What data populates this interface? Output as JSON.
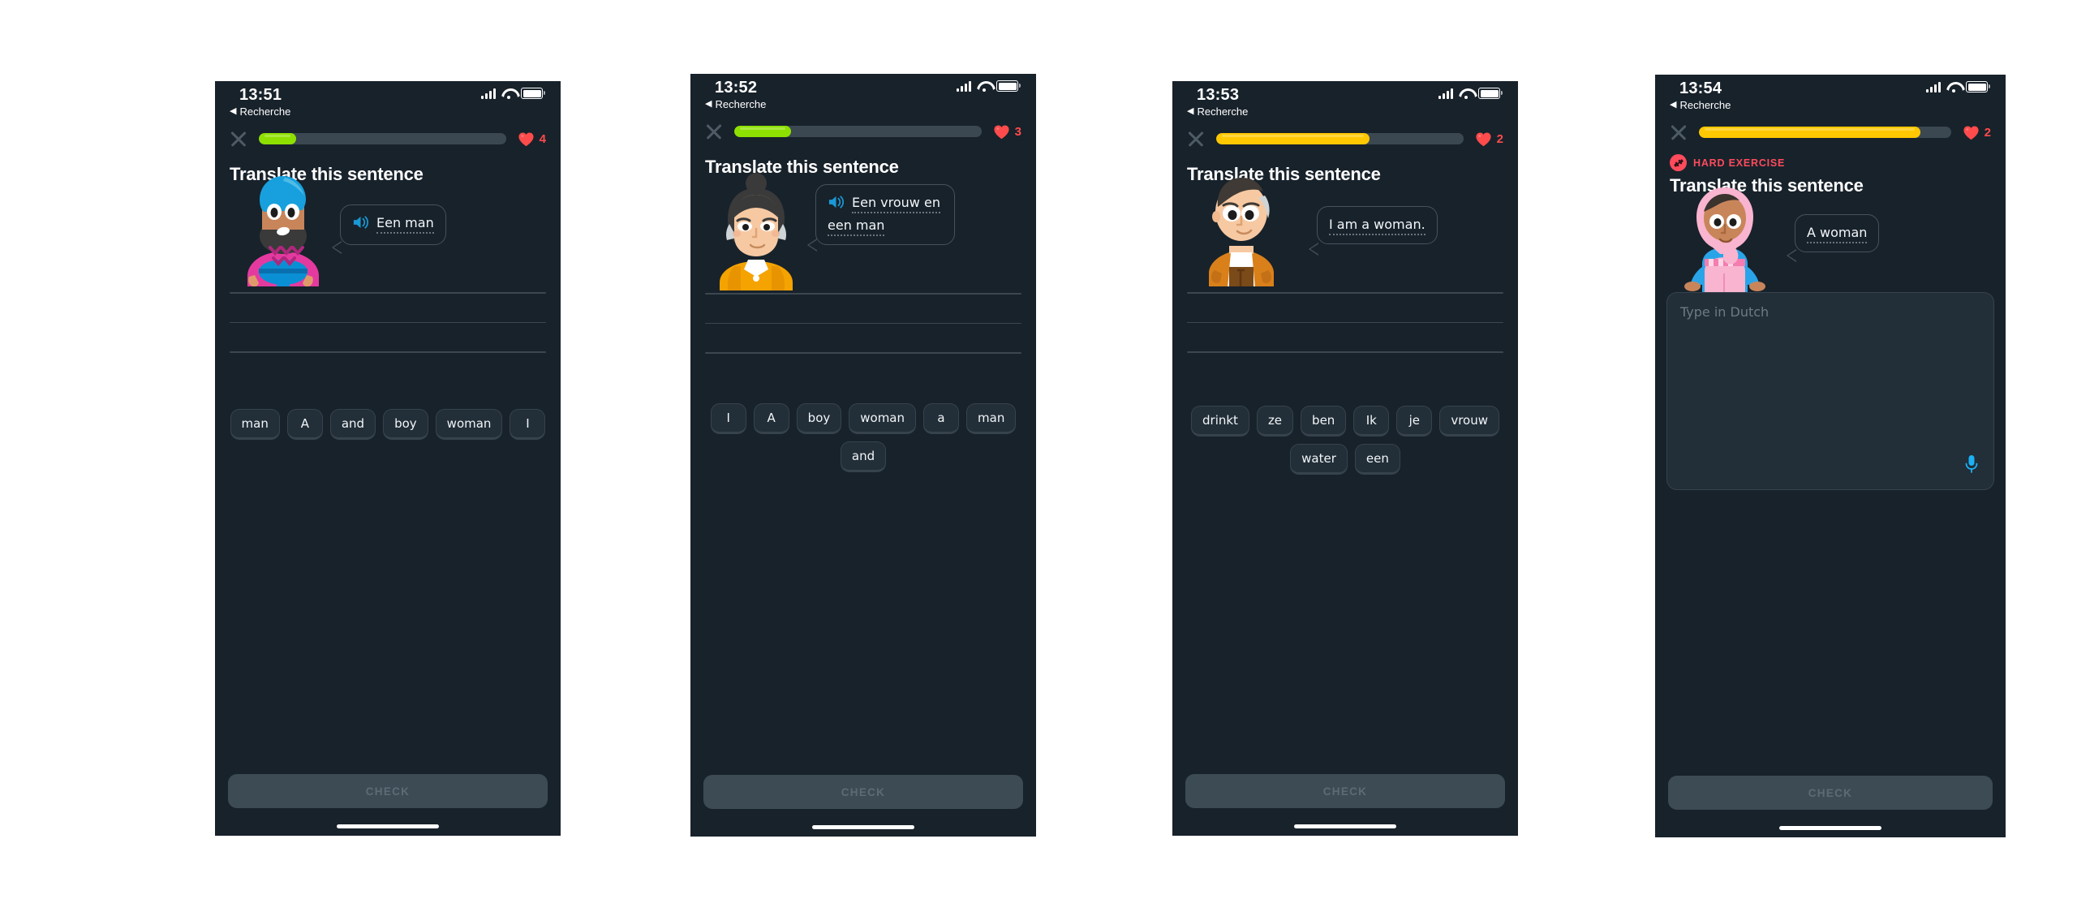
{
  "colors": {
    "screen_bg": "#18222b",
    "progress_green": "#8ee000",
    "progress_yellow": "#ffc800",
    "progress_track": "#3b4852",
    "heart_red": "#ff4b4b",
    "hard_red": "#ff4b5c",
    "speaker_blue": "#1899d6",
    "mic_blue": "#1cb0f6",
    "tile_bg": "#222e38",
    "tile_border": "#36434d",
    "check_bg": "#3d4b55",
    "check_text": "#5d6b76"
  },
  "screens": [
    {
      "status": {
        "time": "13:51",
        "back_label": "Recherche",
        "back_arrow": "◀"
      },
      "progress": {
        "percent": 15,
        "color_key": "progress_green"
      },
      "hearts": {
        "count": "4",
        "icon": "heart-icon"
      },
      "close_icon": "close-icon",
      "hard_exercise": null,
      "prompt": "Translate this sentence",
      "character": "man-turban-pink",
      "bubble": {
        "has_speaker": true,
        "speaker_icon": "speaker-icon",
        "lines": [
          "Een man"
        ]
      },
      "answer_lines": 3,
      "word_bank": [
        "man",
        "A",
        "and",
        "boy",
        "woman",
        "I"
      ],
      "textarea": null,
      "check_label": "CHECK"
    },
    {
      "status": {
        "time": "13:52",
        "back_label": "Recherche",
        "back_arrow": "◀"
      },
      "progress": {
        "percent": 23,
        "color_key": "progress_green"
      },
      "hearts": {
        "count": "3",
        "icon": "heart-icon"
      },
      "close_icon": "close-icon",
      "hard_exercise": null,
      "prompt": "Translate this sentence",
      "character": "woman-orange-bun",
      "bubble": {
        "has_speaker": true,
        "speaker_icon": "speaker-icon",
        "lines": [
          "Een vrouw en",
          "een man"
        ]
      },
      "answer_lines": 3,
      "word_bank": [
        "I",
        "A",
        "boy",
        "woman",
        "a",
        "man",
        "and"
      ],
      "textarea": null,
      "check_label": "CHECK"
    },
    {
      "status": {
        "time": "13:53",
        "back_label": "Recherche",
        "back_arrow": "◀"
      },
      "progress": {
        "percent": 62,
        "color_key": "progress_yellow"
      },
      "hearts": {
        "count": "2",
        "icon": "heart-icon"
      },
      "close_icon": "close-icon",
      "hard_exercise": null,
      "prompt": "Translate this sentence",
      "character": "man-orange-jacket",
      "bubble": {
        "has_speaker": false,
        "speaker_icon": null,
        "lines": [
          "I  am  a  woman."
        ]
      },
      "answer_lines": 3,
      "word_bank": [
        "drinkt",
        "ze",
        "ben",
        "Ik",
        "je",
        "vrouw",
        "water",
        "een"
      ],
      "textarea": null,
      "check_label": "CHECK"
    },
    {
      "status": {
        "time": "13:54",
        "back_label": "Recherche",
        "back_arrow": "◀"
      },
      "progress": {
        "percent": 88,
        "color_key": "progress_yellow"
      },
      "hearts": {
        "count": "2",
        "icon": "heart-icon"
      },
      "close_icon": "close-icon",
      "hard_exercise": {
        "label": "HARD EXERCISE",
        "icon": "dumbbell-icon"
      },
      "prompt": "Translate this sentence",
      "character": "woman-pink-hijab",
      "bubble": {
        "has_speaker": false,
        "speaker_icon": null,
        "lines": [
          "A  woman"
        ]
      },
      "answer_lines": 0,
      "word_bank": [],
      "textarea": {
        "placeholder": "Type in Dutch",
        "value": "",
        "mic_icon": "microphone-icon"
      },
      "check_label": "CHECK"
    }
  ]
}
